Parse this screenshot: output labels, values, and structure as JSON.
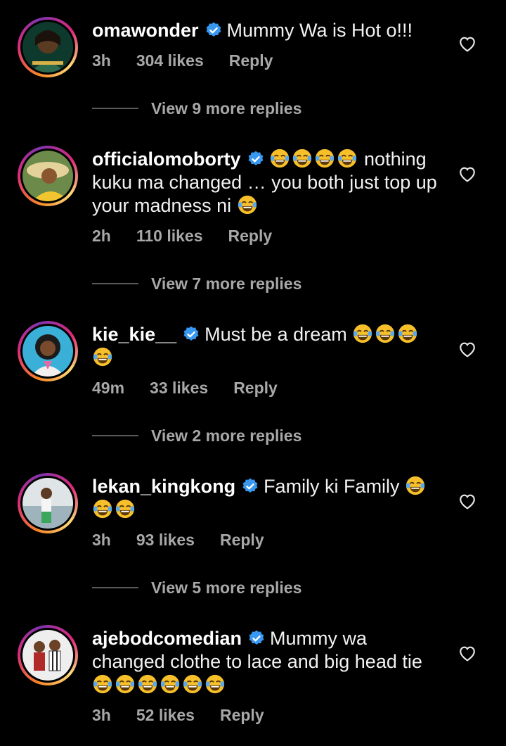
{
  "colors": {
    "background": "#000000",
    "text": "#f2f2f2",
    "muted": "#a8a8a8",
    "verified": "#3897f0"
  },
  "comments": [
    {
      "username": "omawonder",
      "verified": true,
      "text_before": "Mummy Wa is Hot o!!!",
      "emojis": [],
      "text_after": "",
      "trailing_emojis": [],
      "time": "3h",
      "likes": "304 likes",
      "reply_label": "Reply",
      "view_replies": "View 9 more replies",
      "like_icon": "heart-outline-icon"
    },
    {
      "username": "officialomoborty",
      "verified": true,
      "text_before": "",
      "emojis": [
        "face-with-tears-of-joy",
        "face-with-tears-of-joy",
        "face-with-tears-of-joy",
        "face-with-tears-of-joy"
      ],
      "text_after": "nothing kuku ma changed … you both just top up your madness ni",
      "trailing_emojis": [
        "face-with-tears-of-joy"
      ],
      "time": "2h",
      "likes": "110 likes",
      "reply_label": "Reply",
      "view_replies": "View 7 more replies",
      "like_icon": "heart-outline-icon"
    },
    {
      "username": "kie_kie__",
      "verified": true,
      "text_before": "Must be a dream",
      "emojis": [
        "face-with-tears-of-joy",
        "face-with-tears-of-joy",
        "face-with-tears-of-joy",
        "face-with-tears-of-joy"
      ],
      "text_after": "",
      "trailing_emojis": [],
      "time": "49m",
      "likes": "33 likes",
      "reply_label": "Reply",
      "view_replies": "View 2 more replies",
      "like_icon": "heart-outline-icon"
    },
    {
      "username": "lekan_kingkong",
      "verified": true,
      "text_before": "Family ki Family",
      "emojis": [
        "face-with-tears-of-joy",
        "face-with-tears-of-joy",
        "face-with-tears-of-joy"
      ],
      "text_after": "",
      "trailing_emojis": [],
      "time": "3h",
      "likes": "93 likes",
      "reply_label": "Reply",
      "view_replies": "View 5 more replies",
      "like_icon": "heart-outline-icon"
    },
    {
      "username": "ajebodcomedian",
      "verified": true,
      "text_before": "Mummy wa changed clothe to lace and big head tie",
      "emojis": [
        "face-with-tears-of-joy",
        "face-with-tears-of-joy",
        "face-with-tears-of-joy",
        "face-with-tears-of-joy",
        "face-with-tears-of-joy",
        "face-with-tears-of-joy"
      ],
      "text_after": "",
      "trailing_emojis": [],
      "time": "3h",
      "likes": "52 likes",
      "reply_label": "Reply",
      "view_replies": "",
      "like_icon": "heart-outline-icon"
    }
  ]
}
